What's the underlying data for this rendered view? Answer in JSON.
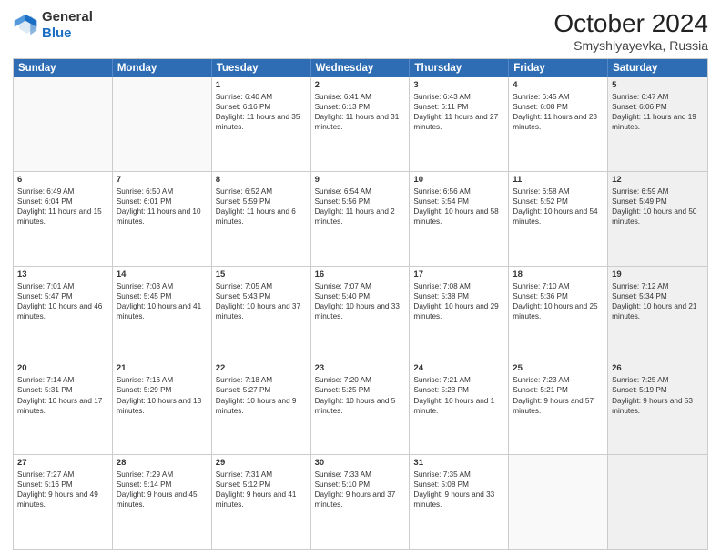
{
  "header": {
    "logo_general": "General",
    "logo_blue": "Blue",
    "title": "October 2024",
    "subtitle": "Smyshlyayevka, Russia"
  },
  "days_of_week": [
    "Sunday",
    "Monday",
    "Tuesday",
    "Wednesday",
    "Thursday",
    "Friday",
    "Saturday"
  ],
  "weeks": [
    [
      {
        "day": "",
        "info": "",
        "shaded": false,
        "empty": true
      },
      {
        "day": "",
        "info": "",
        "shaded": false,
        "empty": true
      },
      {
        "day": "1",
        "info": "Sunrise: 6:40 AM\nSunset: 6:16 PM\nDaylight: 11 hours and 35 minutes.",
        "shaded": false,
        "empty": false
      },
      {
        "day": "2",
        "info": "Sunrise: 6:41 AM\nSunset: 6:13 PM\nDaylight: 11 hours and 31 minutes.",
        "shaded": false,
        "empty": false
      },
      {
        "day": "3",
        "info": "Sunrise: 6:43 AM\nSunset: 6:11 PM\nDaylight: 11 hours and 27 minutes.",
        "shaded": false,
        "empty": false
      },
      {
        "day": "4",
        "info": "Sunrise: 6:45 AM\nSunset: 6:08 PM\nDaylight: 11 hours and 23 minutes.",
        "shaded": false,
        "empty": false
      },
      {
        "day": "5",
        "info": "Sunrise: 6:47 AM\nSunset: 6:06 PM\nDaylight: 11 hours and 19 minutes.",
        "shaded": true,
        "empty": false
      }
    ],
    [
      {
        "day": "6",
        "info": "Sunrise: 6:49 AM\nSunset: 6:04 PM\nDaylight: 11 hours and 15 minutes.",
        "shaded": false,
        "empty": false
      },
      {
        "day": "7",
        "info": "Sunrise: 6:50 AM\nSunset: 6:01 PM\nDaylight: 11 hours and 10 minutes.",
        "shaded": false,
        "empty": false
      },
      {
        "day": "8",
        "info": "Sunrise: 6:52 AM\nSunset: 5:59 PM\nDaylight: 11 hours and 6 minutes.",
        "shaded": false,
        "empty": false
      },
      {
        "day": "9",
        "info": "Sunrise: 6:54 AM\nSunset: 5:56 PM\nDaylight: 11 hours and 2 minutes.",
        "shaded": false,
        "empty": false
      },
      {
        "day": "10",
        "info": "Sunrise: 6:56 AM\nSunset: 5:54 PM\nDaylight: 10 hours and 58 minutes.",
        "shaded": false,
        "empty": false
      },
      {
        "day": "11",
        "info": "Sunrise: 6:58 AM\nSunset: 5:52 PM\nDaylight: 10 hours and 54 minutes.",
        "shaded": false,
        "empty": false
      },
      {
        "day": "12",
        "info": "Sunrise: 6:59 AM\nSunset: 5:49 PM\nDaylight: 10 hours and 50 minutes.",
        "shaded": true,
        "empty": false
      }
    ],
    [
      {
        "day": "13",
        "info": "Sunrise: 7:01 AM\nSunset: 5:47 PM\nDaylight: 10 hours and 46 minutes.",
        "shaded": false,
        "empty": false
      },
      {
        "day": "14",
        "info": "Sunrise: 7:03 AM\nSunset: 5:45 PM\nDaylight: 10 hours and 41 minutes.",
        "shaded": false,
        "empty": false
      },
      {
        "day": "15",
        "info": "Sunrise: 7:05 AM\nSunset: 5:43 PM\nDaylight: 10 hours and 37 minutes.",
        "shaded": false,
        "empty": false
      },
      {
        "day": "16",
        "info": "Sunrise: 7:07 AM\nSunset: 5:40 PM\nDaylight: 10 hours and 33 minutes.",
        "shaded": false,
        "empty": false
      },
      {
        "day": "17",
        "info": "Sunrise: 7:08 AM\nSunset: 5:38 PM\nDaylight: 10 hours and 29 minutes.",
        "shaded": false,
        "empty": false
      },
      {
        "day": "18",
        "info": "Sunrise: 7:10 AM\nSunset: 5:36 PM\nDaylight: 10 hours and 25 minutes.",
        "shaded": false,
        "empty": false
      },
      {
        "day": "19",
        "info": "Sunrise: 7:12 AM\nSunset: 5:34 PM\nDaylight: 10 hours and 21 minutes.",
        "shaded": true,
        "empty": false
      }
    ],
    [
      {
        "day": "20",
        "info": "Sunrise: 7:14 AM\nSunset: 5:31 PM\nDaylight: 10 hours and 17 minutes.",
        "shaded": false,
        "empty": false
      },
      {
        "day": "21",
        "info": "Sunrise: 7:16 AM\nSunset: 5:29 PM\nDaylight: 10 hours and 13 minutes.",
        "shaded": false,
        "empty": false
      },
      {
        "day": "22",
        "info": "Sunrise: 7:18 AM\nSunset: 5:27 PM\nDaylight: 10 hours and 9 minutes.",
        "shaded": false,
        "empty": false
      },
      {
        "day": "23",
        "info": "Sunrise: 7:20 AM\nSunset: 5:25 PM\nDaylight: 10 hours and 5 minutes.",
        "shaded": false,
        "empty": false
      },
      {
        "day": "24",
        "info": "Sunrise: 7:21 AM\nSunset: 5:23 PM\nDaylight: 10 hours and 1 minute.",
        "shaded": false,
        "empty": false
      },
      {
        "day": "25",
        "info": "Sunrise: 7:23 AM\nSunset: 5:21 PM\nDaylight: 9 hours and 57 minutes.",
        "shaded": false,
        "empty": false
      },
      {
        "day": "26",
        "info": "Sunrise: 7:25 AM\nSunset: 5:19 PM\nDaylight: 9 hours and 53 minutes.",
        "shaded": true,
        "empty": false
      }
    ],
    [
      {
        "day": "27",
        "info": "Sunrise: 7:27 AM\nSunset: 5:16 PM\nDaylight: 9 hours and 49 minutes.",
        "shaded": false,
        "empty": false
      },
      {
        "day": "28",
        "info": "Sunrise: 7:29 AM\nSunset: 5:14 PM\nDaylight: 9 hours and 45 minutes.",
        "shaded": false,
        "empty": false
      },
      {
        "day": "29",
        "info": "Sunrise: 7:31 AM\nSunset: 5:12 PM\nDaylight: 9 hours and 41 minutes.",
        "shaded": false,
        "empty": false
      },
      {
        "day": "30",
        "info": "Sunrise: 7:33 AM\nSunset: 5:10 PM\nDaylight: 9 hours and 37 minutes.",
        "shaded": false,
        "empty": false
      },
      {
        "day": "31",
        "info": "Sunrise: 7:35 AM\nSunset: 5:08 PM\nDaylight: 9 hours and 33 minutes.",
        "shaded": false,
        "empty": false
      },
      {
        "day": "",
        "info": "",
        "shaded": false,
        "empty": true
      },
      {
        "day": "",
        "info": "",
        "shaded": true,
        "empty": true
      }
    ]
  ]
}
